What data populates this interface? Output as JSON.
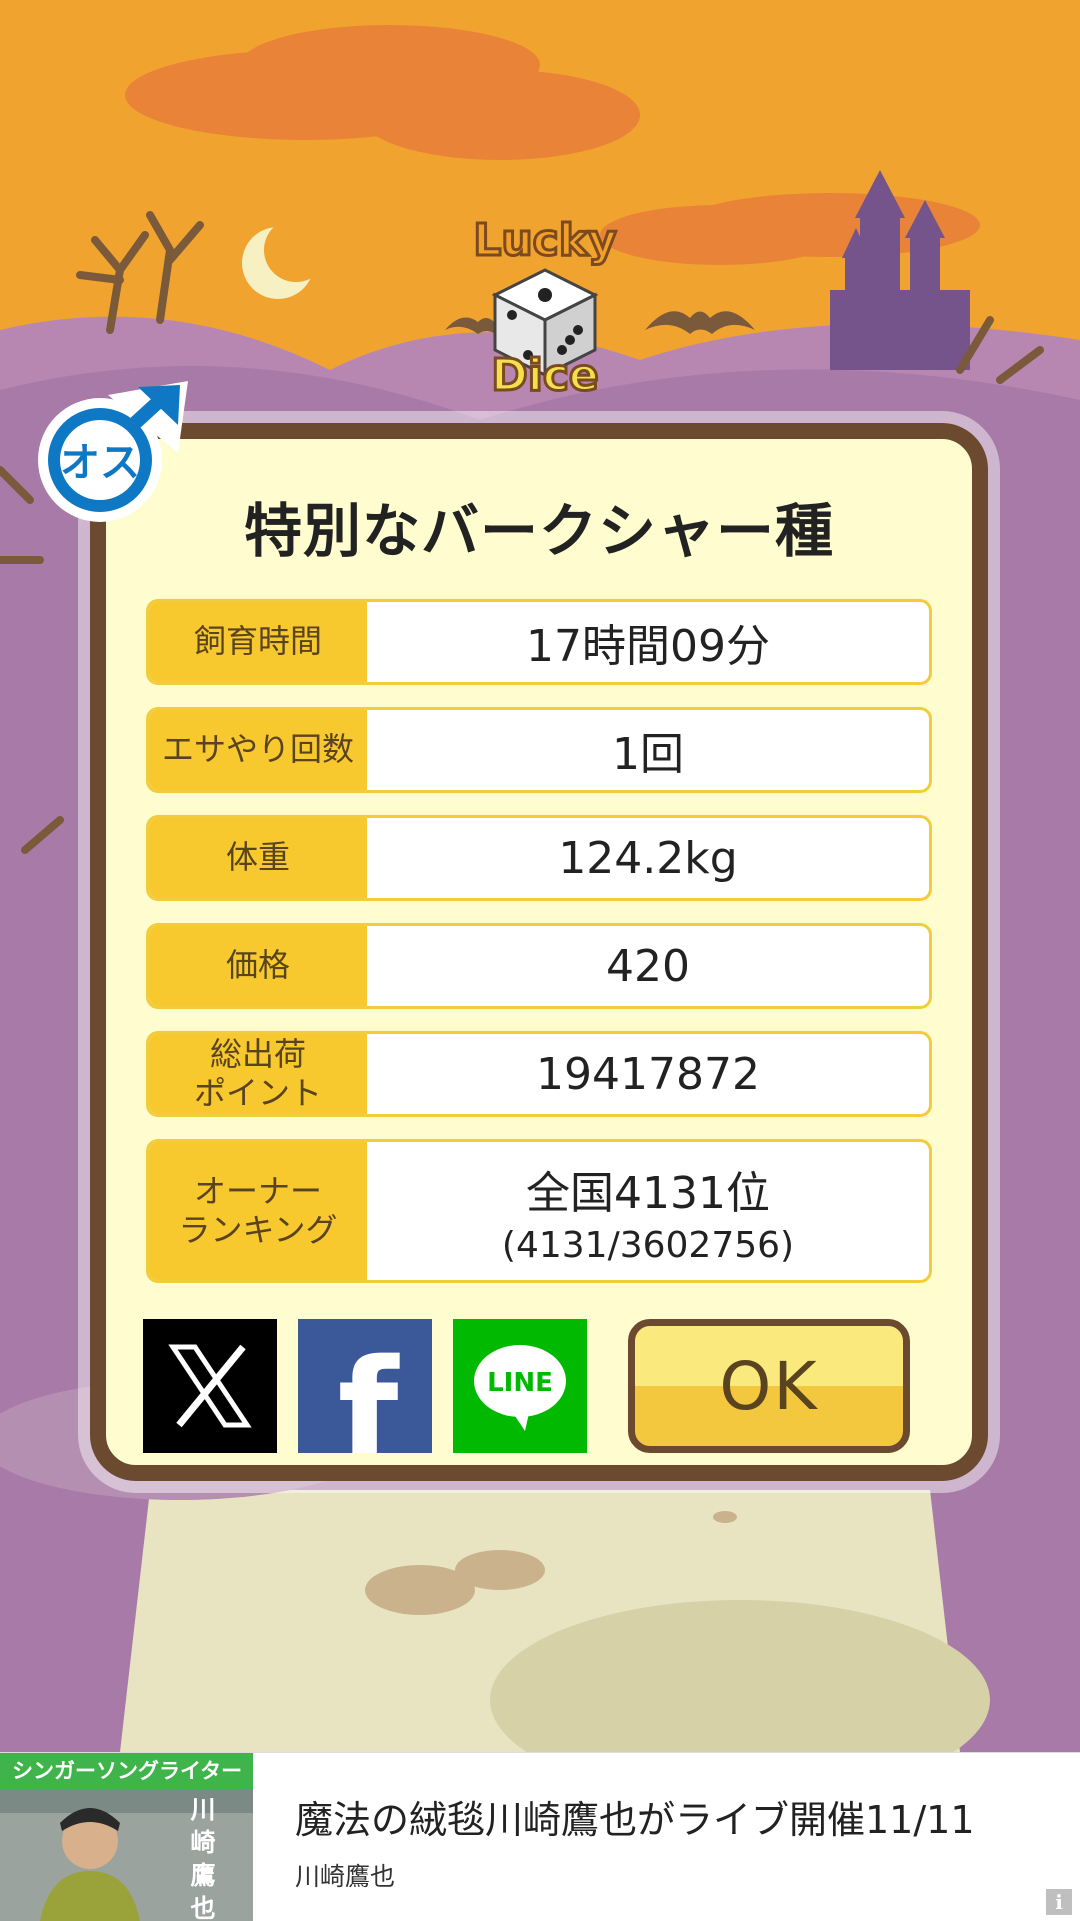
{
  "colors": {
    "sky": "#f0a32f",
    "cloud": "#e98337",
    "hill": "#a77aa8",
    "card_bg": "#fffdd0",
    "card_border": "#6b4a30",
    "label_bg": "#f7c92e",
    "gender_blue": "#0f78c4"
  },
  "logo": {
    "top": "Lucky",
    "bottom": "Dice"
  },
  "gender_badge": {
    "text": "オス"
  },
  "card": {
    "title": "特別なバークシャー種",
    "rows": [
      {
        "label": "飼育時間",
        "value": "17時間09分",
        "sub": ""
      },
      {
        "label": "エサやり回数",
        "value": "1回",
        "sub": ""
      },
      {
        "label": "体重",
        "value": "124.2kg",
        "sub": ""
      },
      {
        "label": "価格",
        "value": "420",
        "sub": ""
      },
      {
        "label": "総出荷\nポイント",
        "value": "19417872",
        "sub": ""
      },
      {
        "label": "オーナー\nランキング",
        "value": "全国4131位",
        "sub": "(4131/3602756)"
      }
    ]
  },
  "share": {
    "facebook_glyph": "f",
    "line_label": "LINE"
  },
  "ok_label": "OK",
  "ad": {
    "tag": "シンガーソングライター",
    "vertical_name": "川崎鷹也",
    "title": "魔法の絨毯川崎鷹也がライブ開催11/11",
    "subtitle": "川崎鷹也",
    "info_glyph": "i"
  }
}
